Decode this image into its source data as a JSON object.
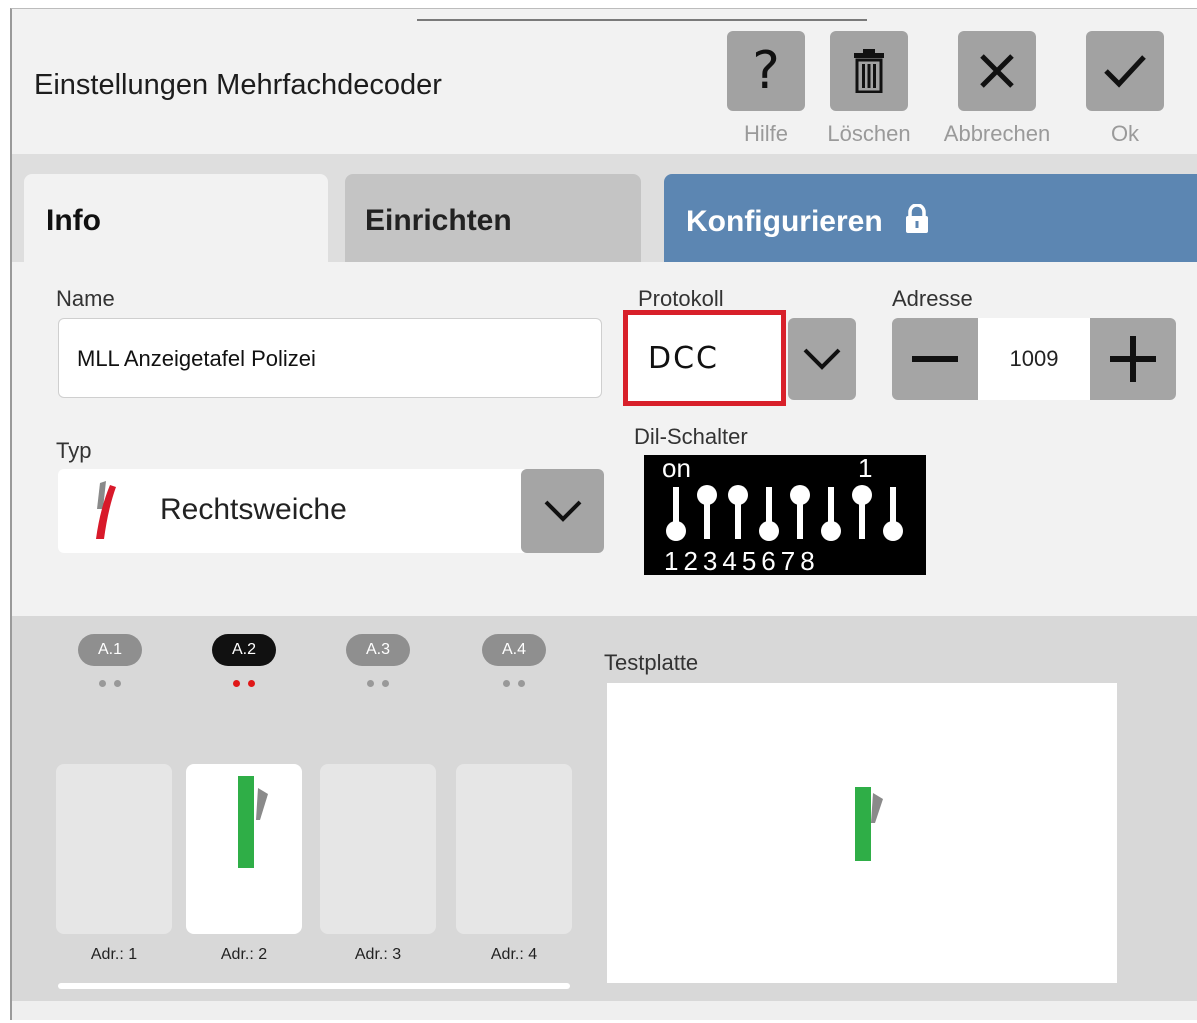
{
  "window": {
    "title": "Einstellungen Mehrfachdecoder"
  },
  "toolbar": {
    "help": {
      "icon": "question-icon",
      "label": "Hilfe"
    },
    "delete": {
      "icon": "trash-icon",
      "label": "Löschen"
    },
    "cancel": {
      "icon": "close-icon",
      "label": "Abbrechen"
    },
    "ok": {
      "icon": "check-icon",
      "label": "Ok"
    }
  },
  "tabs": [
    {
      "label": "Info",
      "active": true
    },
    {
      "label": "Einrichten",
      "active": false
    },
    {
      "label": "Konfigurieren",
      "icon": "lock-icon",
      "active": false
    }
  ],
  "form": {
    "name": {
      "label": "Name",
      "value": "MLL Anzeigetafel Polizei"
    },
    "protocol": {
      "label": "Protokoll",
      "value": "DCC"
    },
    "address": {
      "label": "Adresse",
      "value": "1009"
    },
    "type": {
      "label": "Typ",
      "value": "Rechtsweiche",
      "icon": "right-turnout-icon"
    },
    "dip": {
      "label": "Dil-Schalter",
      "on_label": "on",
      "one_label": "1",
      "numbers": "12345678",
      "positions": [
        "off",
        "on",
        "on",
        "off",
        "on",
        "off",
        "on",
        "off"
      ]
    }
  },
  "outputs": [
    {
      "badge": "A.1",
      "address": "Adr.: 1",
      "active": false
    },
    {
      "badge": "A.2",
      "address": "Adr.: 2",
      "active": true
    },
    {
      "badge": "A.3",
      "address": "Adr.: 3",
      "active": false
    },
    {
      "badge": "A.4",
      "address": "Adr.: 4",
      "active": false
    }
  ],
  "testplate": {
    "label": "Testplatte"
  },
  "colors": {
    "accent_blue": "#5c86b2",
    "highlight_red": "#d8202a",
    "signal_green": "#2fae47",
    "turnout_red": "#d8192a"
  }
}
